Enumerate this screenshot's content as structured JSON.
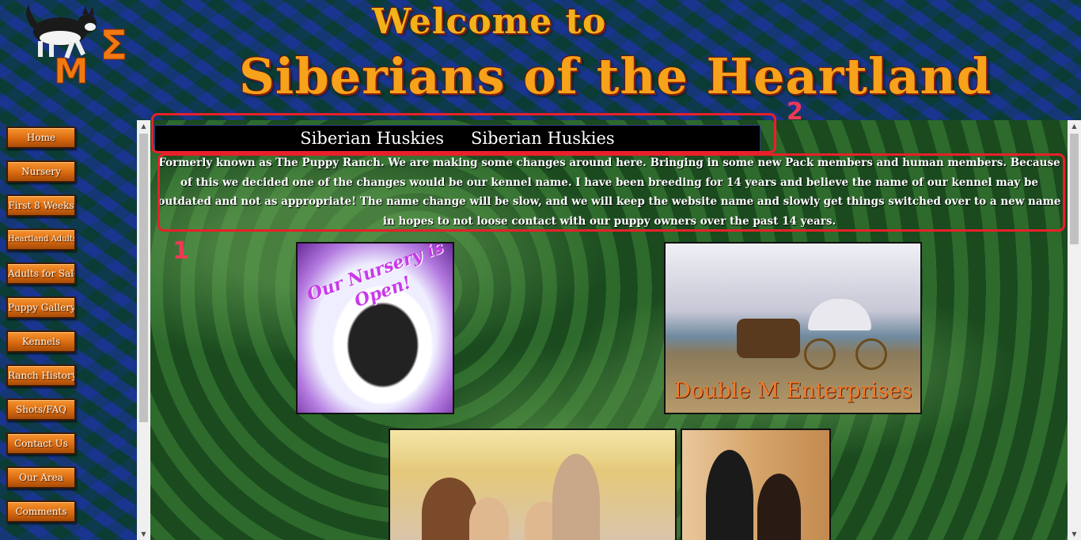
{
  "header": {
    "welcome": "Welcome to",
    "site_title": "Siberians of the Heartland"
  },
  "nav": {
    "items": [
      "Home",
      "Nursery",
      "First 8 Weeks",
      "Heartland Adults",
      "Adults for Sale",
      "Puppy Gallery",
      "Kennels",
      "Ranch History",
      "Shots/FAQ",
      "Contact Us",
      "Our Area",
      "Comments"
    ]
  },
  "main": {
    "banner": [
      "Siberian Huskies",
      "Siberian Huskies"
    ],
    "intro": "Formerly known as  The Puppy Ranch.  We are making some changes around here.  Bringing in some new Pack members and human members.  Because of this we decided one of the changes would be our kennel name.  I have been breeding for 14 years and believe the name of our kennel may be outdated and not as appropriate!  The name change will be slow, and we will keep the website name and slowly get things switched over to a new name in hopes to not loose contact with our puppy owners over the past 14 years.",
    "photos": {
      "nursery_caption": "Our Nursery is Open!",
      "doublem_caption": "Double M Enterprises"
    }
  },
  "annotations": {
    "label_1": "1",
    "label_2": "2"
  },
  "colors": {
    "nav_orange": "#e07418",
    "title_orange": "#f6a21a",
    "annotation_red": "#e8202a",
    "background_green": "#225623"
  }
}
